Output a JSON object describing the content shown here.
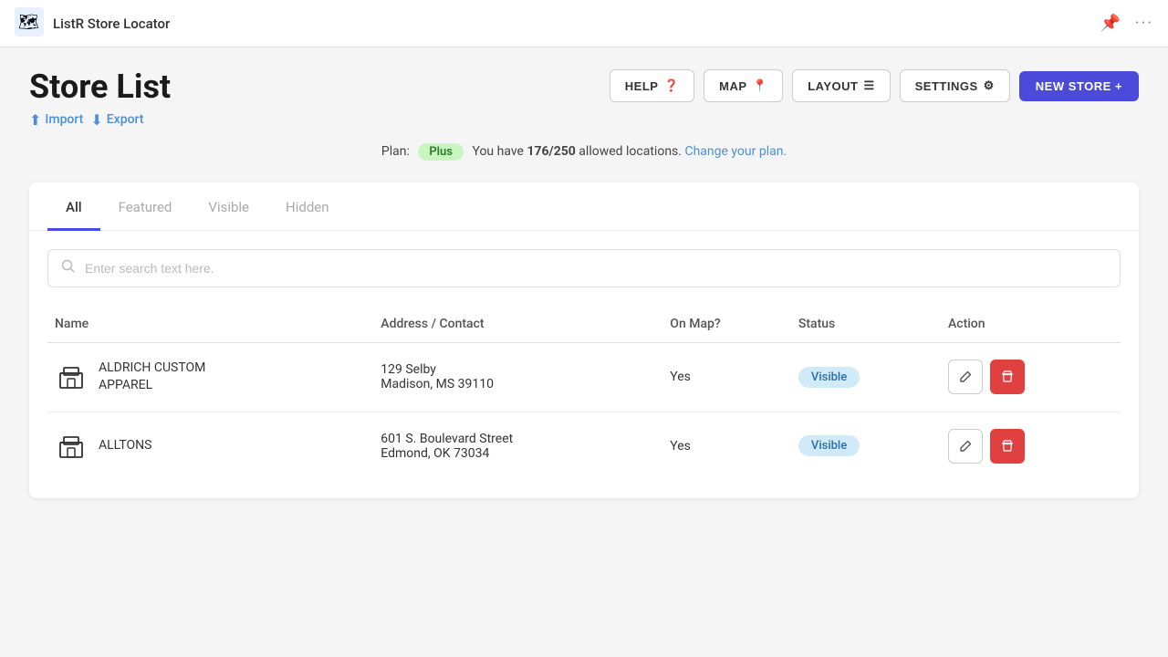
{
  "app": {
    "title": "ListR Store Locator"
  },
  "topbar": {
    "pin_icon": "📌",
    "menu_icon": "···"
  },
  "header": {
    "page_title": "Store List",
    "import_label": "Import",
    "export_label": "Export"
  },
  "toolbar": {
    "help_label": "HELP",
    "map_label": "MAP",
    "layout_label": "LAYOUT",
    "settings_label": "SETTINGS",
    "new_store_label": "NEW STORE +"
  },
  "plan": {
    "label": "Plan:",
    "badge": "Plus",
    "message_prefix": "You have ",
    "used": "176/250",
    "message_suffix": " allowed locations.",
    "change_link": "Change your plan."
  },
  "tabs": [
    {
      "id": "all",
      "label": "All",
      "active": true
    },
    {
      "id": "featured",
      "label": "Featured",
      "active": false
    },
    {
      "id": "visible",
      "label": "Visible",
      "active": false
    },
    {
      "id": "hidden",
      "label": "Hidden",
      "active": false
    }
  ],
  "search": {
    "placeholder": "Enter search text here."
  },
  "table": {
    "columns": [
      {
        "id": "name",
        "label": "Name"
      },
      {
        "id": "address",
        "label": "Address / Contact"
      },
      {
        "id": "on_map",
        "label": "On Map?"
      },
      {
        "id": "status",
        "label": "Status"
      },
      {
        "id": "action",
        "label": "Action"
      }
    ],
    "rows": [
      {
        "id": 1,
        "name": "ALDRICH CUSTOM\nAPPAREL",
        "name_line1": "ALDRICH CUSTOM",
        "name_line2": "APPAREL",
        "address_line1": "129 Selby",
        "address_line2": "Madison, MS 39110",
        "on_map": "Yes",
        "status": "Visible"
      },
      {
        "id": 2,
        "name": "ALLTONS",
        "name_line1": "ALLTONS",
        "name_line2": "",
        "address_line1": "601 S. Boulevard Street",
        "address_line2": "Edmond, OK 73034",
        "on_map": "Yes",
        "status": "Visible"
      }
    ]
  }
}
